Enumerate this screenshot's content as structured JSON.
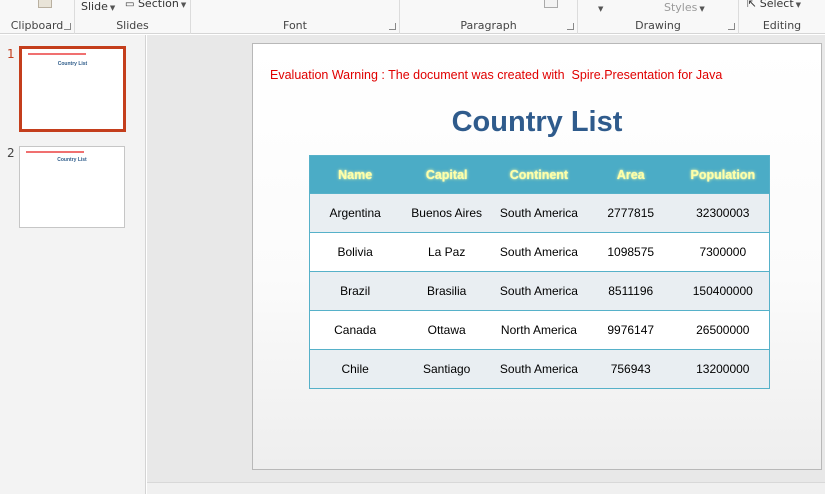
{
  "ribbon": {
    "groups": {
      "clipboard": "Clipboard",
      "slides": "Slides",
      "font": "Font",
      "paragraph": "Paragraph",
      "drawing": "Drawing",
      "editing": "Editing"
    },
    "buttons": {
      "slide": "Slide",
      "section": "Section",
      "styles": "Styles",
      "select": "Select"
    }
  },
  "thumbnails": [
    {
      "number": "1",
      "selected": true
    },
    {
      "number": "2",
      "selected": false
    }
  ],
  "slide": {
    "warning": "Evaluation Warning : The document was created with  Spire.Presentation for Java",
    "title": "Country List",
    "table": {
      "headers": [
        "Name",
        "Capital",
        "Continent",
        "Area",
        "Population"
      ],
      "rows": [
        [
          "Argentina",
          "Buenos Aires",
          "South America",
          "2777815",
          "32300003"
        ],
        [
          "Bolivia",
          "La Paz",
          "South America",
          "1098575",
          "7300000"
        ],
        [
          "Brazil",
          "Brasilia",
          "South America",
          "8511196",
          "150400000"
        ],
        [
          "Canada",
          "Ottawa",
          "North America",
          "9976147",
          "26500000"
        ],
        [
          "Chile",
          "Santiago",
          "South America",
          "756943",
          "13200000"
        ]
      ]
    }
  },
  "colors": {
    "header_fill": "#4bacc6",
    "header_text": "#ffffa6",
    "title": "#2f5b8c",
    "warning": "#e00000",
    "selection": "#c43e1c"
  }
}
